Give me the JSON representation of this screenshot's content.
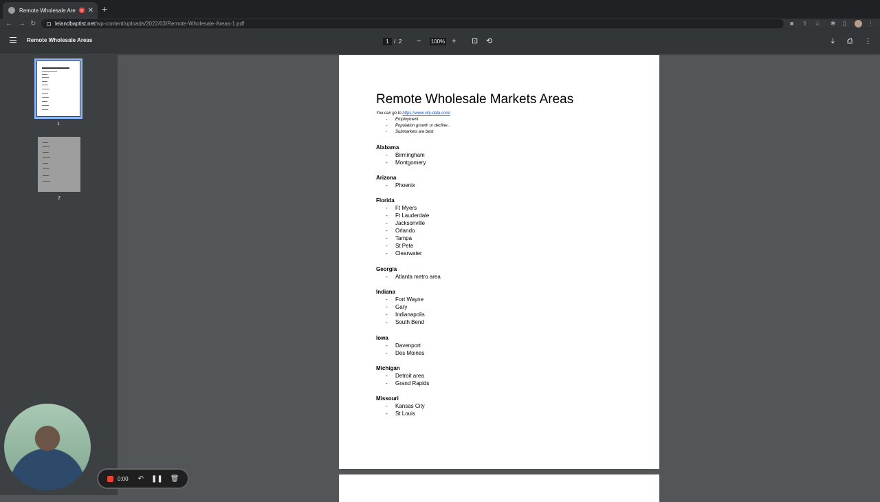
{
  "browser": {
    "tab_title": "Remote Wholesale Areas",
    "url_host": "lelandbaptist.net",
    "url_path": "/wp-content/uploads/2022/03/Remote-Wholesale-Areas-1.pdf"
  },
  "viewer": {
    "doc_title": "Remote Wholesale Areas",
    "page_current": "1",
    "page_sep": "/",
    "page_total": "2",
    "zoom": "100%",
    "thumbnails": [
      {
        "number": "1"
      },
      {
        "number": "2"
      }
    ]
  },
  "document": {
    "heading": "Remote Wholesale Markets Areas",
    "intro_prefix": "You can go to ",
    "intro_link": "https://www.city-data.com/",
    "bullets": [
      "Employment",
      "Population growth or decline..",
      "Submarkets are best"
    ],
    "states": [
      {
        "name": "Alabama",
        "cities": [
          "Birmingham",
          "Montgomery"
        ]
      },
      {
        "name": "Arizona",
        "cities": [
          "Phoenix"
        ]
      },
      {
        "name": "Florida",
        "cities": [
          "Ft Myers",
          "Ft Lauderdale",
          "Jacksonville",
          "Orlando",
          "Tampa",
          "St Pete",
          "Clearwater"
        ]
      },
      {
        "name": "Georgia",
        "cities": [
          "Atlanta metro area"
        ]
      },
      {
        "name": "Indiana",
        "cities": [
          "Fort Wayne",
          "Gary",
          "Indianapolis",
          "South Bend"
        ]
      },
      {
        "name": "Iowa",
        "cities": [
          "Davenport",
          "Des Moines"
        ]
      },
      {
        "name": "Michigan",
        "cities": [
          "Detroit area",
          "Grand Rapids"
        ]
      },
      {
        "name": "Missouri",
        "cities": [
          "Kansas City",
          "St Louis"
        ]
      }
    ]
  },
  "recorder": {
    "time": "0:00"
  }
}
